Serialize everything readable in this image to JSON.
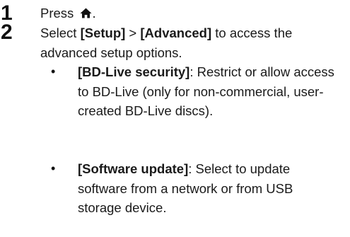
{
  "steps": [
    {
      "number": "1",
      "text": "Press ",
      "suffix": "."
    },
    {
      "number": "2",
      "text_prefix": "Select ",
      "bold_1": "[Setup]",
      "separator": " > ",
      "bold_2": "[Advanced]",
      "text_suffix": " to access the advanced setup options."
    }
  ],
  "bullets": [
    {
      "symbol": "•",
      "label": "[BD-Live security]",
      "description": ": Restrict or allow access to BD-Live (only for non-commercial, user-created BD-Live discs)."
    },
    {
      "symbol": "•",
      "label": "[Software update]",
      "description": ": Select to update software from a network or from USB storage device."
    }
  ],
  "icons": {
    "home": "home-icon"
  }
}
